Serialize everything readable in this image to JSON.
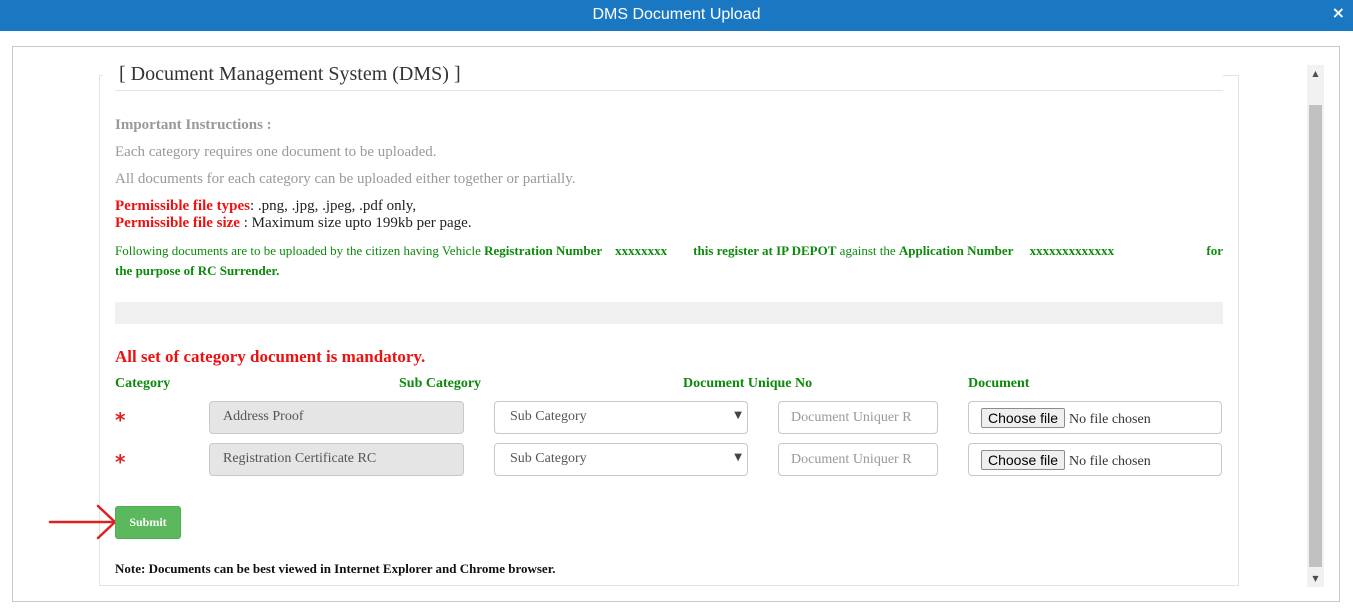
{
  "window": {
    "title": "DMS Document Upload",
    "close_glyph": "×"
  },
  "legend": "[ Document Management System (DMS) ]",
  "instructions": {
    "heading": "Important Instructions :",
    "line1": "Each category requires one document to be uploaded.",
    "line2": "All documents for each category can be uploaded either together or partially.",
    "file_types_label": "Permissible file types",
    "file_types_value": ": .png, .jpg, .jpeg, .pdf only,",
    "file_size_label": "Permissible file size",
    "file_size_value": " : Maximum size upto 199kb per page."
  },
  "notice": {
    "prefix": "Following documents are to be uploaded by the citizen having Vehicle ",
    "reg_label": "Registration Number",
    "reg_value": "xxxxxxxx",
    "middle_bold": "this register at IP DEPOT",
    "middle": " against the ",
    "app_label": "Application Number",
    "app_value": "xxxxxxxxxxxxx",
    "trailing": "for",
    "purpose": "the purpose of RC Surrender."
  },
  "mandatory_text": "All set of category document is mandatory.",
  "columns": {
    "category": "Category",
    "sub_category": "Sub Category",
    "unique_no": "Document Unique No",
    "document": "Document"
  },
  "rows": [
    {
      "star": "*",
      "category": "Address Proof",
      "sub_category": "Sub Category",
      "unique_placeholder": "Document Uniquer R",
      "file_button": "Choose file",
      "file_status": "No file chosen"
    },
    {
      "star": "*",
      "category": "Registration Certificate RC",
      "sub_category": "Sub Category",
      "unique_placeholder": "Document Uniquer R",
      "file_button": "Choose file",
      "file_status": "No file chosen"
    }
  ],
  "submit_label": "Submit",
  "note": "Note: Documents can be best viewed in Internet Explorer and Chrome browser.",
  "icons": {
    "close": "close-icon",
    "dropdown": "chevron-down-icon",
    "annotation": "red-arrow-icon"
  },
  "colors": {
    "titlebar": "#1a78c2",
    "green": "#0b8a0b",
    "red": "#ee1111",
    "submit": "#5cb85c"
  }
}
